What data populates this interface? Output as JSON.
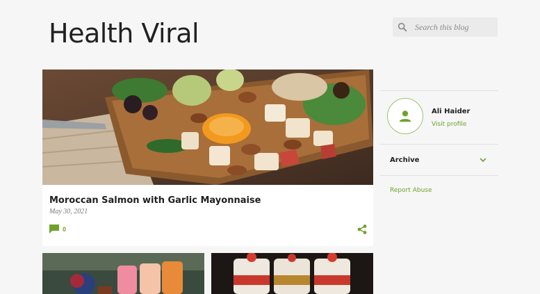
{
  "header": {
    "blog_title": "Health Viral"
  },
  "search": {
    "placeholder": "Search this blog",
    "icon": "search-icon"
  },
  "featured_post": {
    "title": "Moroccan Salmon with Garlic Mayonnaise",
    "date": "May 30, 2021",
    "comment_count": "0",
    "comment_icon": "comment-icon",
    "share_icon": "share-icon"
  },
  "sidebar": {
    "profile": {
      "name": "Ali Haider",
      "link_label": "Visit profile",
      "icon": "person-icon"
    },
    "archive": {
      "label": "Archive",
      "icon": "chevron-down-icon"
    },
    "report_abuse_label": "Report Abuse"
  },
  "colors": {
    "accent": "#6ea22d",
    "background": "#f6f6f6",
    "card": "#ffffff",
    "title_text": "#212121"
  }
}
